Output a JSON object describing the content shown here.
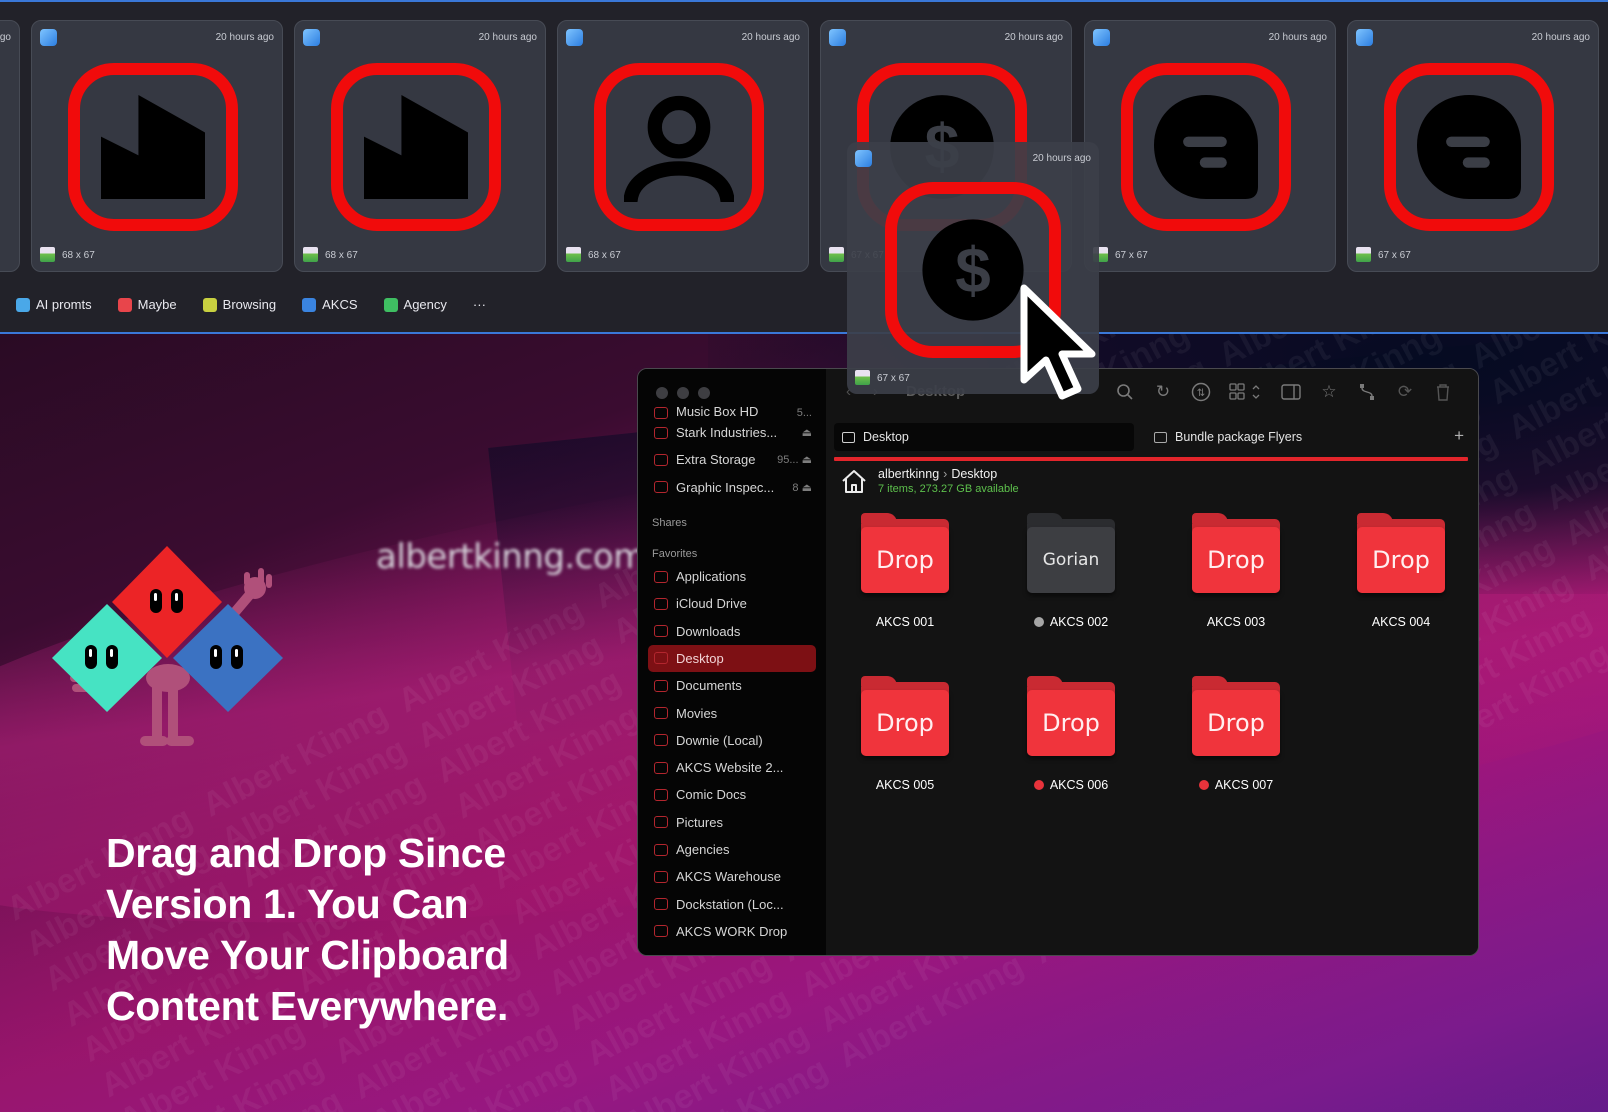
{
  "clipboard": {
    "cards": [
      {
        "time": "20 hours ago",
        "dims": "68 x 67",
        "glyph": "factory-icon"
      },
      {
        "time": "20 hours ago",
        "dims": "68 x 67",
        "glyph": "factory-icon"
      },
      {
        "time": "20 hours ago",
        "dims": "68 x 67",
        "glyph": "user-icon"
      },
      {
        "time": "20 hours ago",
        "dims": "67 x 67",
        "glyph": "dollar-coin-icon"
      },
      {
        "time": "20 hours ago",
        "dims": "67 x 67",
        "glyph": "blogger-icon"
      },
      {
        "time": "20 hours ago",
        "dims": "67 x 67",
        "glyph": "blogger-icon"
      }
    ],
    "partial_left_time": "ago",
    "drag_ghost": {
      "time": "20 hours ago",
      "dims": "67 x 67",
      "glyph": "dollar-coin-icon"
    },
    "tags": [
      {
        "label": "AI promts",
        "color": "#4aa8e8",
        "icon": "gear-icon"
      },
      {
        "label": "Maybe",
        "color": "#e8454b",
        "icon": "fan-icon"
      },
      {
        "label": "Browsing",
        "color": "#c8d040",
        "icon": "leaf-icon"
      },
      {
        "label": "AKCS",
        "color": "#3a84e0",
        "icon": "cap-icon"
      },
      {
        "label": "Agency",
        "color": "#3fbf62",
        "icon": "flag-icon"
      }
    ],
    "more_label": "···"
  },
  "promo": {
    "site_url": "albertkinng.com",
    "headline_lines": [
      "Drag and Drop Since",
      "Version 1. You Can",
      "Move Your Clipboard",
      "Content Everywhere."
    ],
    "watermark": "Albert Kinng"
  },
  "finder": {
    "title": "Desktop",
    "sidebar": {
      "locations": [
        {
          "label": "Music Box HD",
          "extra": "5..."
        },
        {
          "label": "Stark Industries...",
          "extra": "⏏"
        },
        {
          "label": "Extra Storage",
          "extra": "95... ⏏"
        },
        {
          "label": "Graphic Inspec...",
          "extra": "8 ⏏"
        }
      ],
      "shares_heading": "Shares",
      "favorites_heading": "Favorites",
      "favorites": [
        {
          "label": "Applications",
          "icon": "applications-icon"
        },
        {
          "label": "iCloud Drive",
          "icon": "cloud-icon"
        },
        {
          "label": "Downloads",
          "icon": "download-icon"
        },
        {
          "label": "Desktop",
          "icon": "desktop-icon",
          "active": true
        },
        {
          "label": "Documents",
          "icon": "document-icon"
        },
        {
          "label": "Movies",
          "icon": "film-icon"
        },
        {
          "label": "Downie (Local)",
          "icon": "folder-icon"
        },
        {
          "label": "AKCS Website 2...",
          "icon": "folder-icon"
        },
        {
          "label": "Comic Docs",
          "icon": "folder-icon"
        },
        {
          "label": "Pictures",
          "icon": "pictures-icon"
        },
        {
          "label": "Agencies",
          "icon": "agencies-icon"
        },
        {
          "label": "AKCS Warehouse",
          "icon": "download-box-icon"
        },
        {
          "label": "Dockstation (Loc...",
          "icon": "ship-icon"
        },
        {
          "label": "AKCS WORK Drop",
          "icon": "person-share-icon"
        }
      ]
    },
    "tabs": [
      {
        "label": "Desktop",
        "active": true
      },
      {
        "label": "Bundle package Flyers",
        "active": false
      }
    ],
    "path": {
      "user": "albertkinng",
      "folder": "Desktop"
    },
    "status": "7 items, 273.27 GB available",
    "items": [
      {
        "name": "AKCS 001",
        "face": "Drop",
        "style": "red",
        "tag": null
      },
      {
        "name": "AKCS 002",
        "face": "Gorian",
        "style": "dark",
        "tag": "#a6a6a6"
      },
      {
        "name": "AKCS 003",
        "face": "Drop",
        "style": "red",
        "tag": null
      },
      {
        "name": "AKCS 004",
        "face": "Drop",
        "style": "red",
        "tag": null
      },
      {
        "name": "AKCS 005",
        "face": "Drop",
        "style": "red",
        "tag": null
      },
      {
        "name": "AKCS 006",
        "face": "Drop",
        "style": "red",
        "tag": "#e8333b"
      },
      {
        "name": "AKCS 007",
        "face": "Drop",
        "style": "red",
        "tag": "#e8333b"
      }
    ]
  },
  "colors": {
    "accent_blue": "#3a78d8",
    "thumb_red": "#f10b0b",
    "folder_red": "#f0343c",
    "sidebar_active": "#7d1014",
    "status_green": "#5dc04c"
  }
}
